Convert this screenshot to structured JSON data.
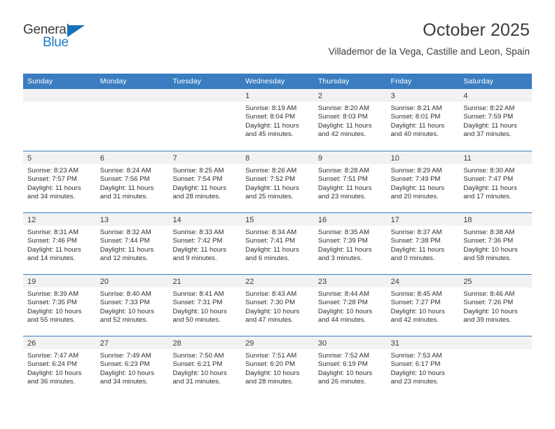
{
  "brand": {
    "name_part1": "General",
    "name_part2": "Blue",
    "triangle_icon": "triangle-icon",
    "blue": "#1472bd"
  },
  "header": {
    "title": "October 2025",
    "subtitle": "Villademor de la Vega, Castille and Leon, Spain"
  },
  "colors": {
    "header_blue": "#3a7dc0",
    "day_band_gray": "#f2f2f2",
    "text": "#3c3c3c"
  },
  "calendar": {
    "weekday_headers": [
      "Sunday",
      "Monday",
      "Tuesday",
      "Wednesday",
      "Thursday",
      "Friday",
      "Saturday"
    ],
    "weeks": [
      [
        {
          "day": "",
          "empty": true
        },
        {
          "day": "",
          "empty": true
        },
        {
          "day": "",
          "empty": true
        },
        {
          "day": "1",
          "sunrise": "Sunrise: 8:19 AM",
          "sunset": "Sunset: 8:04 PM",
          "daylight": "Daylight: 11 hours and 45 minutes."
        },
        {
          "day": "2",
          "sunrise": "Sunrise: 8:20 AM",
          "sunset": "Sunset: 8:03 PM",
          "daylight": "Daylight: 11 hours and 42 minutes."
        },
        {
          "day": "3",
          "sunrise": "Sunrise: 8:21 AM",
          "sunset": "Sunset: 8:01 PM",
          "daylight": "Daylight: 11 hours and 40 minutes."
        },
        {
          "day": "4",
          "sunrise": "Sunrise: 8:22 AM",
          "sunset": "Sunset: 7:59 PM",
          "daylight": "Daylight: 11 hours and 37 minutes."
        }
      ],
      [
        {
          "day": "5",
          "sunrise": "Sunrise: 8:23 AM",
          "sunset": "Sunset: 7:57 PM",
          "daylight": "Daylight: 11 hours and 34 minutes."
        },
        {
          "day": "6",
          "sunrise": "Sunrise: 8:24 AM",
          "sunset": "Sunset: 7:56 PM",
          "daylight": "Daylight: 11 hours and 31 minutes."
        },
        {
          "day": "7",
          "sunrise": "Sunrise: 8:25 AM",
          "sunset": "Sunset: 7:54 PM",
          "daylight": "Daylight: 11 hours and 28 minutes."
        },
        {
          "day": "8",
          "sunrise": "Sunrise: 8:26 AM",
          "sunset": "Sunset: 7:52 PM",
          "daylight": "Daylight: 11 hours and 25 minutes."
        },
        {
          "day": "9",
          "sunrise": "Sunrise: 8:28 AM",
          "sunset": "Sunset: 7:51 PM",
          "daylight": "Daylight: 11 hours and 23 minutes."
        },
        {
          "day": "10",
          "sunrise": "Sunrise: 8:29 AM",
          "sunset": "Sunset: 7:49 PM",
          "daylight": "Daylight: 11 hours and 20 minutes."
        },
        {
          "day": "11",
          "sunrise": "Sunrise: 8:30 AM",
          "sunset": "Sunset: 7:47 PM",
          "daylight": "Daylight: 11 hours and 17 minutes."
        }
      ],
      [
        {
          "day": "12",
          "sunrise": "Sunrise: 8:31 AM",
          "sunset": "Sunset: 7:46 PM",
          "daylight": "Daylight: 11 hours and 14 minutes."
        },
        {
          "day": "13",
          "sunrise": "Sunrise: 8:32 AM",
          "sunset": "Sunset: 7:44 PM",
          "daylight": "Daylight: 11 hours and 12 minutes."
        },
        {
          "day": "14",
          "sunrise": "Sunrise: 8:33 AM",
          "sunset": "Sunset: 7:42 PM",
          "daylight": "Daylight: 11 hours and 9 minutes."
        },
        {
          "day": "15",
          "sunrise": "Sunrise: 8:34 AM",
          "sunset": "Sunset: 7:41 PM",
          "daylight": "Daylight: 11 hours and 6 minutes."
        },
        {
          "day": "16",
          "sunrise": "Sunrise: 8:35 AM",
          "sunset": "Sunset: 7:39 PM",
          "daylight": "Daylight: 11 hours and 3 minutes."
        },
        {
          "day": "17",
          "sunrise": "Sunrise: 8:37 AM",
          "sunset": "Sunset: 7:38 PM",
          "daylight": "Daylight: 11 hours and 0 minutes."
        },
        {
          "day": "18",
          "sunrise": "Sunrise: 8:38 AM",
          "sunset": "Sunset: 7:36 PM",
          "daylight": "Daylight: 10 hours and 58 minutes."
        }
      ],
      [
        {
          "day": "19",
          "sunrise": "Sunrise: 8:39 AM",
          "sunset": "Sunset: 7:35 PM",
          "daylight": "Daylight: 10 hours and 55 minutes."
        },
        {
          "day": "20",
          "sunrise": "Sunrise: 8:40 AM",
          "sunset": "Sunset: 7:33 PM",
          "daylight": "Daylight: 10 hours and 52 minutes."
        },
        {
          "day": "21",
          "sunrise": "Sunrise: 8:41 AM",
          "sunset": "Sunset: 7:31 PM",
          "daylight": "Daylight: 10 hours and 50 minutes."
        },
        {
          "day": "22",
          "sunrise": "Sunrise: 8:43 AM",
          "sunset": "Sunset: 7:30 PM",
          "daylight": "Daylight: 10 hours and 47 minutes."
        },
        {
          "day": "23",
          "sunrise": "Sunrise: 8:44 AM",
          "sunset": "Sunset: 7:28 PM",
          "daylight": "Daylight: 10 hours and 44 minutes."
        },
        {
          "day": "24",
          "sunrise": "Sunrise: 8:45 AM",
          "sunset": "Sunset: 7:27 PM",
          "daylight": "Daylight: 10 hours and 42 minutes."
        },
        {
          "day": "25",
          "sunrise": "Sunrise: 8:46 AM",
          "sunset": "Sunset: 7:26 PM",
          "daylight": "Daylight: 10 hours and 39 minutes."
        }
      ],
      [
        {
          "day": "26",
          "sunrise": "Sunrise: 7:47 AM",
          "sunset": "Sunset: 6:24 PM",
          "daylight": "Daylight: 10 hours and 36 minutes."
        },
        {
          "day": "27",
          "sunrise": "Sunrise: 7:49 AM",
          "sunset": "Sunset: 6:23 PM",
          "daylight": "Daylight: 10 hours and 34 minutes."
        },
        {
          "day": "28",
          "sunrise": "Sunrise: 7:50 AM",
          "sunset": "Sunset: 6:21 PM",
          "daylight": "Daylight: 10 hours and 31 minutes."
        },
        {
          "day": "29",
          "sunrise": "Sunrise: 7:51 AM",
          "sunset": "Sunset: 6:20 PM",
          "daylight": "Daylight: 10 hours and 28 minutes."
        },
        {
          "day": "30",
          "sunrise": "Sunrise: 7:52 AM",
          "sunset": "Sunset: 6:19 PM",
          "daylight": "Daylight: 10 hours and 26 minutes."
        },
        {
          "day": "31",
          "sunrise": "Sunrise: 7:53 AM",
          "sunset": "Sunset: 6:17 PM",
          "daylight": "Daylight: 10 hours and 23 minutes."
        },
        {
          "day": "",
          "empty": true
        }
      ]
    ]
  }
}
